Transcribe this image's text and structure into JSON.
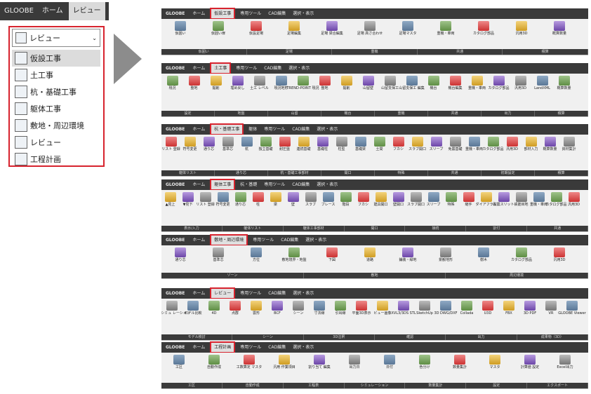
{
  "left_panel": {
    "tabs": [
      "GLOOBE",
      "ホーム",
      "レビュー"
    ],
    "dropdown_value": "レビュー",
    "items": [
      {
        "label": "仮設工事",
        "highlighted": true
      },
      {
        "label": "土工事"
      },
      {
        "label": "杭・基礎工事"
      },
      {
        "label": "躯体工事"
      },
      {
        "label": "敷地・周辺環境"
      },
      {
        "label": "レビュー"
      },
      {
        "label": "工程計画"
      }
    ]
  },
  "ribbons": [
    {
      "tabs": [
        "GLOOBE",
        "ホーム",
        "仮設工事",
        "専用ツール",
        "CAD編集",
        "選択・表示"
      ],
      "active": 2,
      "buttons": [
        "仮囲い",
        "仮囲い扉",
        "仮設足場",
        "足場編集",
        "足場 梁合編集",
        "足場 高さ合わせ",
        "足場マスタ",
        "重機・車両",
        "カタログ部品",
        "汎用3D",
        "概算数量"
      ],
      "groups": [
        "仮囲い",
        "足場",
        "重機",
        "共通",
        "積算"
      ]
    },
    {
      "tabs": [
        "GLOOBE",
        "ホーム",
        "土工事",
        "専用ツール",
        "CAD編集",
        "選択・表示"
      ],
      "active": 2,
      "buttons": [
        "現況",
        "整地",
        "掘削",
        "埋め戻し",
        "土工 レベル",
        "現況地形",
        "TREND-POINT 現況",
        "整地",
        "掘削",
        "山留壁",
        "山留支保工",
        "山留支保工 編集",
        "機台",
        "機台編集",
        "重機・車両",
        "カタログ部品",
        "汎用3D",
        "LandXML",
        "概算数量"
      ],
      "groups": [
        "設定",
        "地盤",
        "山留",
        "機台",
        "重機",
        "共通",
        "出力",
        "積算"
      ]
    },
    {
      "tabs": [
        "GLOOBE",
        "ホーム",
        "杭・基礎工事",
        "躯体",
        "専用ツール",
        "CAD編集",
        "選択・表示"
      ],
      "active": 2,
      "buttons": [
        "リスト 登録",
        "符号変更",
        "通り芯",
        "基準芯",
        "杭",
        "独立基礎",
        "耐圧盤",
        "連続基礎",
        "基礎柱",
        "柱型",
        "基礎梁",
        "土間",
        "フカシ",
        "スラブ開口",
        "スリーブ",
        "免震基礎",
        "重機・車両",
        "カタログ部品",
        "汎用3D",
        "部材入力",
        "概算数量",
        "資材集計"
      ],
      "groups": [
        "躯体リスト",
        "通り芯",
        "杭・基礎工事部材",
        "開口",
        "特殊",
        "共通",
        "初期設定",
        "積算"
      ]
    },
    {
      "tabs": [
        "GLOOBE",
        "ホーム",
        "躯体工事",
        "杭・基礎",
        "専用ツール",
        "CAD編集",
        "選択・表示"
      ],
      "active": 2,
      "buttons": [
        "▲見上",
        "▼見下",
        "リスト 登録",
        "符号変更",
        "通り芯",
        "柱",
        "梁",
        "壁",
        "スラブ",
        "ブレース",
        "階段",
        "フカシ",
        "建具開口",
        "壁開口",
        "スラブ開口",
        "スリーブ",
        "特殊",
        "継手",
        "ダイアフラム",
        "耐震スリット",
        "鉄筋目地",
        "重機・車両",
        "カタログ部品",
        "汎用3D"
      ],
      "groups": [
        "表示/入力",
        "躯体リスト",
        "躯体工事部材",
        "開口",
        "接続",
        "割付",
        "共通"
      ]
    },
    {
      "tabs": [
        "GLOOBE",
        "ホーム",
        "敷地・周辺環境",
        "専用ツール",
        "CAD編集",
        "選択・表示"
      ],
      "active": 2,
      "buttons": [
        "通り芯",
        "基準芯",
        "方位",
        "敷地境界・地盤",
        "下図",
        "道路",
        "鋪装・緑地",
        "景観地形",
        "樹木",
        "カタログ部品",
        "汎用3D"
      ],
      "groups": [
        "ゾーン",
        "敷地",
        "周辺環境"
      ]
    },
    {
      "tabs": [
        "GLOOBE",
        "ホーム",
        "レビュー",
        "専用ツール",
        "CAD編集",
        "選択・表示"
      ],
      "active": 2,
      "buttons": [
        "日陰シミュ レーション",
        "モデル比較",
        "4D",
        "点群",
        "雲形",
        "BCF",
        "シーン",
        "寸法線",
        "引出線",
        "平面3D表示",
        "ビュー画像",
        "XVL3/3DS STL",
        "SketchUp",
        "3D DWG/DXF",
        "Collada",
        "U3D",
        "FBX",
        "3D PDF",
        "VR",
        "GLOOBE Viewer"
      ],
      "groups": [
        "モデル検討",
        "シーン",
        "3D注釈",
        "確認",
        "出力",
        "成果物（3D）"
      ]
    },
    {
      "tabs": [
        "GLOOBE",
        "ホーム",
        "工程計画",
        "専用ツール",
        "CAD編集",
        "選択・表示"
      ],
      "active": 2,
      "buttons": [
        "工区",
        "自動作成",
        "工数算定 マスタ",
        "汎用 作業項目",
        "割り当て 編集",
        "出力日",
        "日付",
        "色分け",
        "数量集計",
        "マスタ",
        "計算値 設定",
        "Excel出力"
      ],
      "groups": [
        "工区",
        "自動作成",
        "工程表",
        "シミュレーション",
        "数量集計",
        "設定",
        "エクスポート"
      ]
    }
  ]
}
